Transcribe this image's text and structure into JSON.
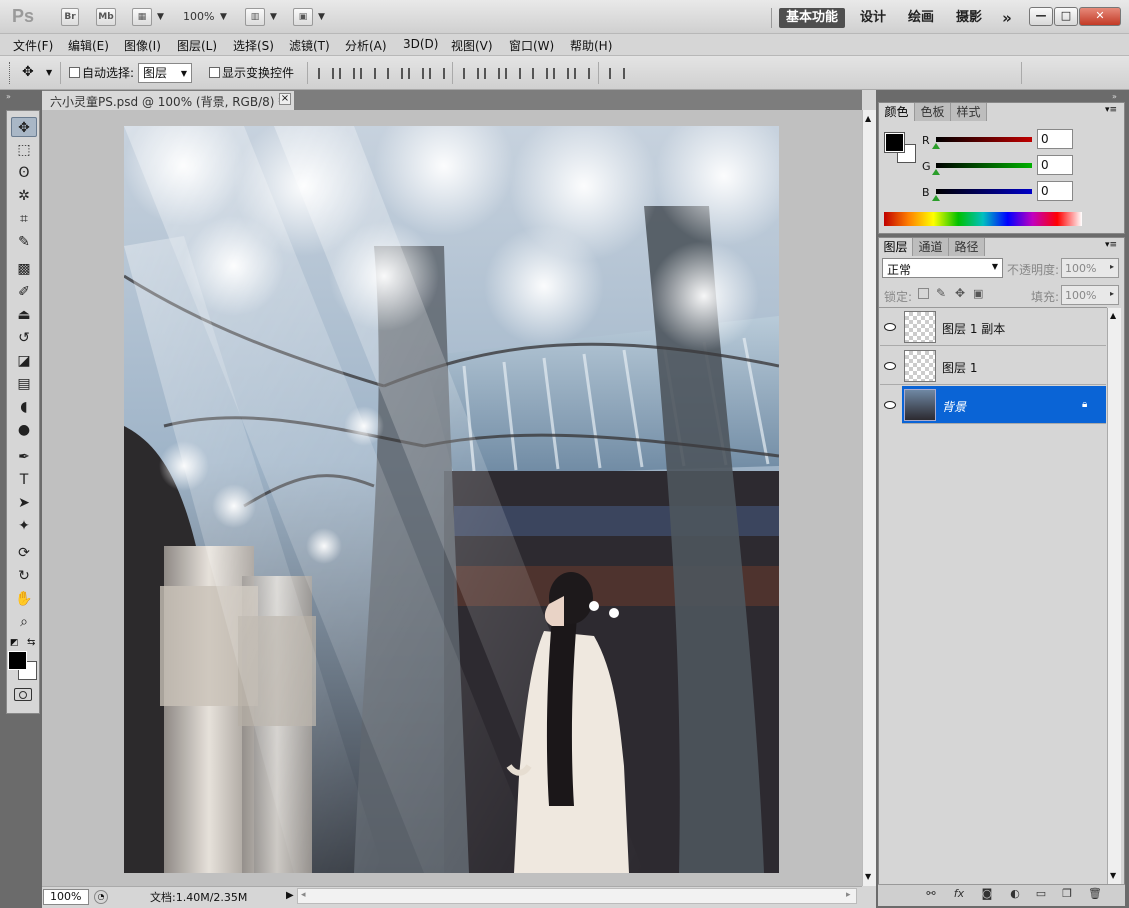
{
  "app": {
    "logo": "Ps",
    "bridge_label": "Br",
    "minibridge_label": "Mb",
    "zoom": "100%"
  },
  "workspaces": [
    "基本功能",
    "设计",
    "绘画",
    "摄影"
  ],
  "window": {
    "more": "»",
    "minimize": "—",
    "restore": "□",
    "close": "✕"
  },
  "menu": [
    "文件(F)",
    "编辑(E)",
    "图像(I)",
    "图层(L)",
    "选择(S)",
    "滤镜(T)",
    "分析(A)",
    "3D(D)",
    "视图(V)",
    "窗口(W)",
    "帮助(H)"
  ],
  "options": {
    "auto_select_label": "自动选择:",
    "auto_select_value": "图层",
    "show_transform_label": "显示变换控件"
  },
  "document": {
    "tab_title": "六小灵童PS.psd @ 100% (背景, RGB/8) *",
    "close": "×",
    "status_zoom": "100%",
    "status_info": "文档:1.40M/2.35M"
  },
  "color_panel": {
    "tabs": [
      "颜色",
      "色板",
      "样式"
    ],
    "r_label": "R",
    "g_label": "G",
    "b_label": "B",
    "r": "0",
    "g": "0",
    "b": "0",
    "colors": {
      "red": "#c00000",
      "green": "#00b000",
      "blue": "#0000c8"
    }
  },
  "layers_panel": {
    "tabs": [
      "图层",
      "通道",
      "路径"
    ],
    "blend_mode": "正常",
    "opacity_label": "不透明度:",
    "opacity": "100%",
    "lock_label": "锁定:",
    "fill_label": "填充:",
    "fill": "100%",
    "layers": [
      {
        "name": "图层 1 副本",
        "selected": false
      },
      {
        "name": "图层 1",
        "selected": false
      },
      {
        "name": "背景",
        "selected": true
      }
    ]
  },
  "accent": "#0a64d6"
}
